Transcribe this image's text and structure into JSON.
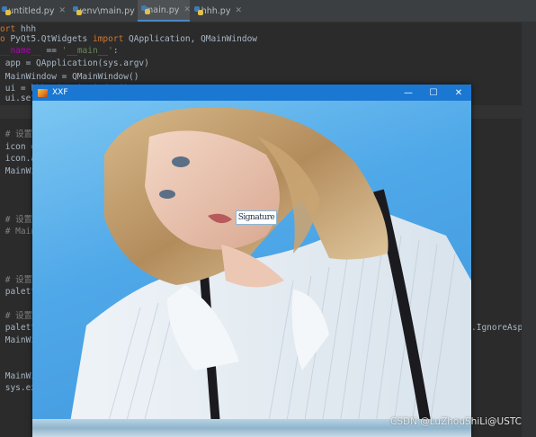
{
  "tabs": [
    {
      "label": "untitled.py",
      "active": false
    },
    {
      "label": "venv\\main.py",
      "active": false
    },
    {
      "label": "main.py",
      "active": true
    },
    {
      "label": "hhh.py",
      "active": false
    }
  ],
  "code_lines": [
    {
      "text": "ort hhh"
    },
    {
      "text": "o PyQt5.QtWidgets import QApplication, QMainWindow"
    },
    {
      "text": "__name__ == '__main__':"
    },
    {
      "text": "app = QApplication(sys.argv)"
    },
    {
      "text": "MainWindow = QMainWindow()"
    },
    {
      "text": "ui = hhh.Ui_MainWindow()"
    },
    {
      "text": "ui.setu"
    },
    {
      "text": "# 设置"
    },
    {
      "text": "icon ="
    },
    {
      "text": "icon.a"
    },
    {
      "text": "MainWi"
    },
    {
      "text": "# 设置"
    },
    {
      "text": "# Main"
    },
    {
      "text": "# 设置"
    },
    {
      "text": "palett"
    },
    {
      "text": "# 设置"
    },
    {
      "text": "palett"
    },
    {
      "text": "MainWi"
    },
    {
      "text": "MainWi"
    },
    {
      "text": "sys.ex"
    }
  ],
  "right_code": ".IgnoreAspectRa",
  "qt_window": {
    "title": "XXF",
    "minimize": "—",
    "maximize": "☐",
    "close": "✕",
    "overlay_label": "Signature"
  },
  "watermark": "CSDN @LuZhouShiLi@USTC",
  "colors": {
    "titlebar": "#1a77d2",
    "editor_bg": "#2b2b2b",
    "keyword": "#cc7832",
    "string": "#6a8759",
    "comment": "#808080"
  },
  "icons": {
    "tab_icon": "python-file-icon",
    "qt_icon": "app-icon"
  }
}
